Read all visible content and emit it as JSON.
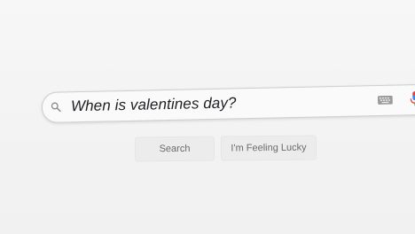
{
  "search": {
    "query": "When is valentines day?",
    "search_button": "Search",
    "lucky_button": "I'm Feeling Lucky"
  },
  "icons": {
    "search": "search-icon",
    "keyboard": "keyboard-icon",
    "microphone": "microphone-icon"
  },
  "colors": {
    "background": "#f3f3f3",
    "text": "#202124",
    "button_bg": "#ececec",
    "button_text": "#6a6a6a",
    "mic_red": "#ea4335",
    "mic_blue": "#4285f4"
  }
}
